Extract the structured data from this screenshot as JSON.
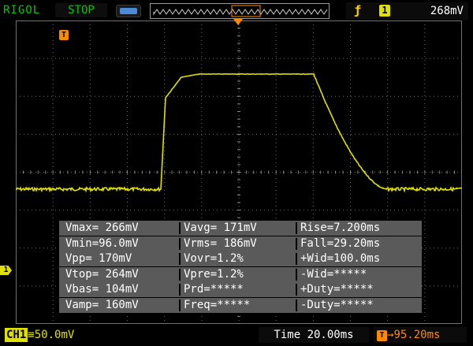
{
  "header": {
    "brand": "RIGOL",
    "run_state": "STOP",
    "trigger_channel": "1",
    "trigger_level": "268mV"
  },
  "markers": {
    "delay_marker": "T",
    "channel_marker": "1",
    "trigger_time_marker": "T"
  },
  "measurements": [
    [
      "Vmax= 266mV",
      "Vavg= 171mV",
      "Rise=7.200ms"
    ],
    [
      "Vmin=96.0mV",
      "Vrms= 186mV",
      "Fall=29.20ms"
    ],
    [
      "Vpp= 170mV",
      "Vovr=1.2%",
      "+Wid=100.0ms"
    ],
    [
      "Vtop= 264mV",
      "Vpre=1.2%",
      "-Wid=*****"
    ],
    [
      "Vbas= 104mV",
      "Prd=*****",
      "+Duty=*****"
    ],
    [
      "Vamp= 160mV",
      "Freq=*****",
      "-Duty=*****"
    ]
  ],
  "footer": {
    "channel_tag": "CH1",
    "volts_per_div": "50.0mV",
    "timebase": "Time 20.00ms",
    "trigger_offset": "95.20ms"
  },
  "colors": {
    "trace": "#e0e000",
    "accent_green": "#00cc00",
    "accent_orange": "#ff8a00",
    "text_white": "#ffffff",
    "panel_gray": "#5a5a5a",
    "battery_blue": "#4a8ad8"
  },
  "icons": {
    "battery": "battery-icon",
    "trigger_edge": "rising-edge-icon",
    "memory_bar": "waveform-memory-icon"
  }
}
